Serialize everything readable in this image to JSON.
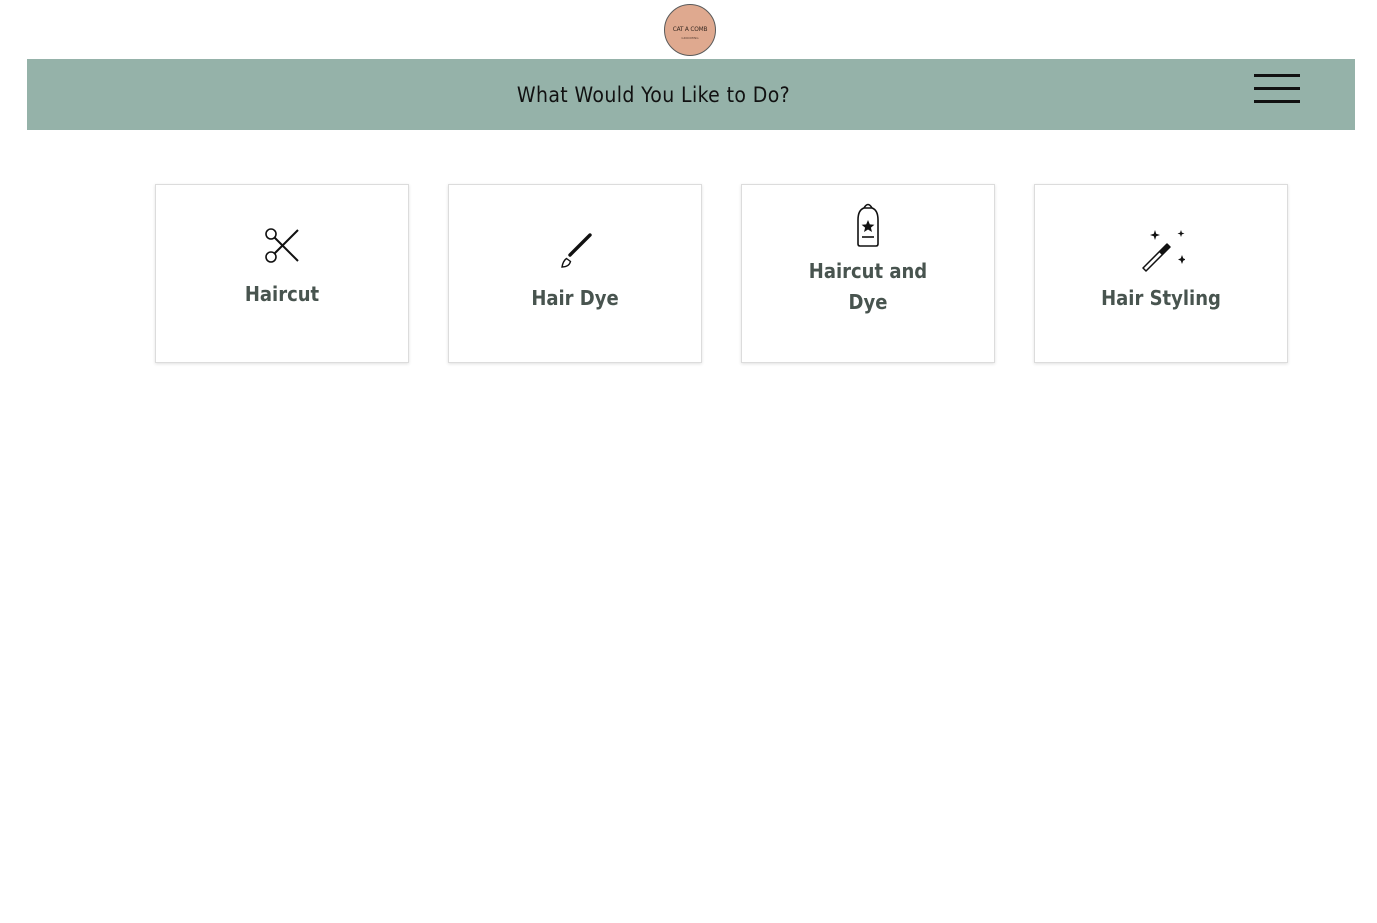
{
  "brand": {
    "logo_text": "CAT A COMB",
    "logo_subtext": "GROOMING"
  },
  "header": {
    "title": "What Would You Like to Do?",
    "menu_icon": "hamburger-icon",
    "background_color": "#95b2a9"
  },
  "services": [
    {
      "label": "Haircut",
      "icon": "scissors-icon"
    },
    {
      "label": "Hair Dye",
      "icon": "paintbrush-icon"
    },
    {
      "label": "Haircut and Dye",
      "icon": "bottle-icon"
    },
    {
      "label": "Hair Styling",
      "icon": "magic-wand-icon"
    }
  ],
  "colors": {
    "label_text": "#48544f",
    "logo_background": "#dfa98f"
  }
}
